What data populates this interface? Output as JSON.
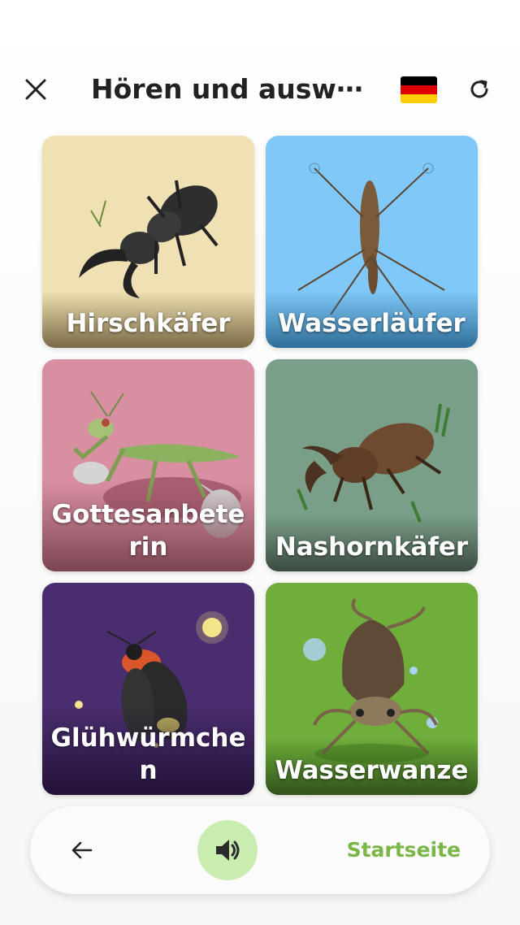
{
  "header": {
    "title": "Hören und ausw⋯",
    "flag_colors": [
      "#000000",
      "#dd0000",
      "#ffce00"
    ]
  },
  "cards": [
    {
      "label": "Hirschkäfer",
      "bg": "#efe1b3",
      "shade": "#7a6a45"
    },
    {
      "label": "Wasserläufer",
      "bg": "#7fc8f8",
      "shade": "#2f6f98"
    },
    {
      "label": "Gottesanbeterin",
      "bg": "#d98fa2",
      "shade": "#7b4450"
    },
    {
      "label": "Nashornkäfer",
      "bg": "#7a9f88",
      "shade": "#3c4c40"
    },
    {
      "label": "Glühwürmchen",
      "bg": "#4a2d6e",
      "shade": "#231238"
    },
    {
      "label": "Wasserwanze",
      "bg": "#6fae3b",
      "shade": "#2f5219"
    }
  ],
  "nav": {
    "home_label": "Startseite",
    "accent": "#7ab648"
  },
  "icons": [
    "close-icon",
    "refresh-icon",
    "germany-flag-icon",
    "arrow-left-icon",
    "speaker-icon"
  ]
}
